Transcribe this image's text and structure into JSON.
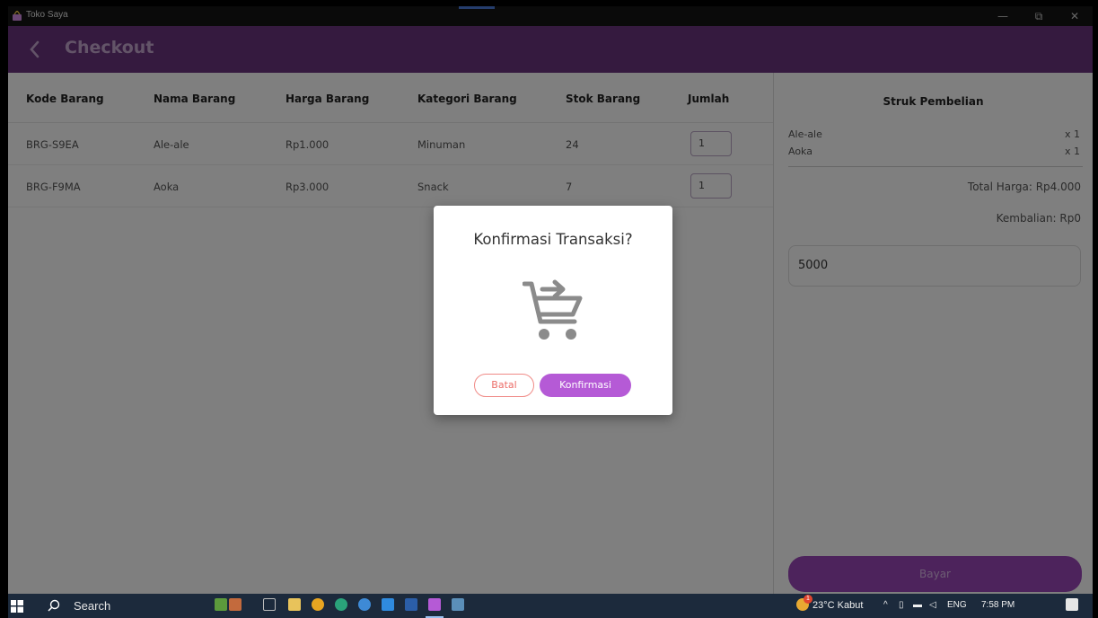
{
  "window": {
    "title": "Toko Saya",
    "controls": {
      "minimize": "—",
      "maximize": "⧉",
      "close": "✕"
    }
  },
  "appbar": {
    "back_icon": "chevron-left-icon",
    "title": "Checkout"
  },
  "table": {
    "headers": [
      "Kode Barang",
      "Nama Barang",
      "Harga Barang",
      "Kategori Barang",
      "Stok Barang",
      "Jumlah"
    ],
    "rows": [
      {
        "kode": "BRG-S9EA",
        "nama": "Ale-ale",
        "harga": "Rp1.000",
        "kategori": "Minuman",
        "stok": "24",
        "jumlah": "1"
      },
      {
        "kode": "BRG-F9MA",
        "nama": "Aoka",
        "harga": "Rp3.000",
        "kategori": "Snack",
        "stok": "7",
        "jumlah": "1"
      }
    ]
  },
  "receipt": {
    "title": "Struk Pembelian",
    "items": [
      {
        "name": "Ale-ale",
        "qty": "x 1"
      },
      {
        "name": "Aoka",
        "qty": "x 1"
      }
    ],
    "total": "Total Harga: Rp4.000",
    "change": "Kembalian: Rp0",
    "cash_value": "5000",
    "pay_label": "Bayar"
  },
  "dialog": {
    "title": "Konfirmasi Transaksi?",
    "icon": "cart-arrow-icon",
    "cancel_label": "Batal",
    "confirm_label": "Konfirmasi"
  },
  "taskbar": {
    "search_label": "Search",
    "weather": "23°C  Kabut",
    "language": "ENG",
    "time": "7:58 PM",
    "notification_count": "1"
  },
  "colors": {
    "appbar": "#6a347e",
    "accent": "#b55ad6",
    "cancel": "#ec6e69",
    "pay_button": "#9a46b8"
  }
}
